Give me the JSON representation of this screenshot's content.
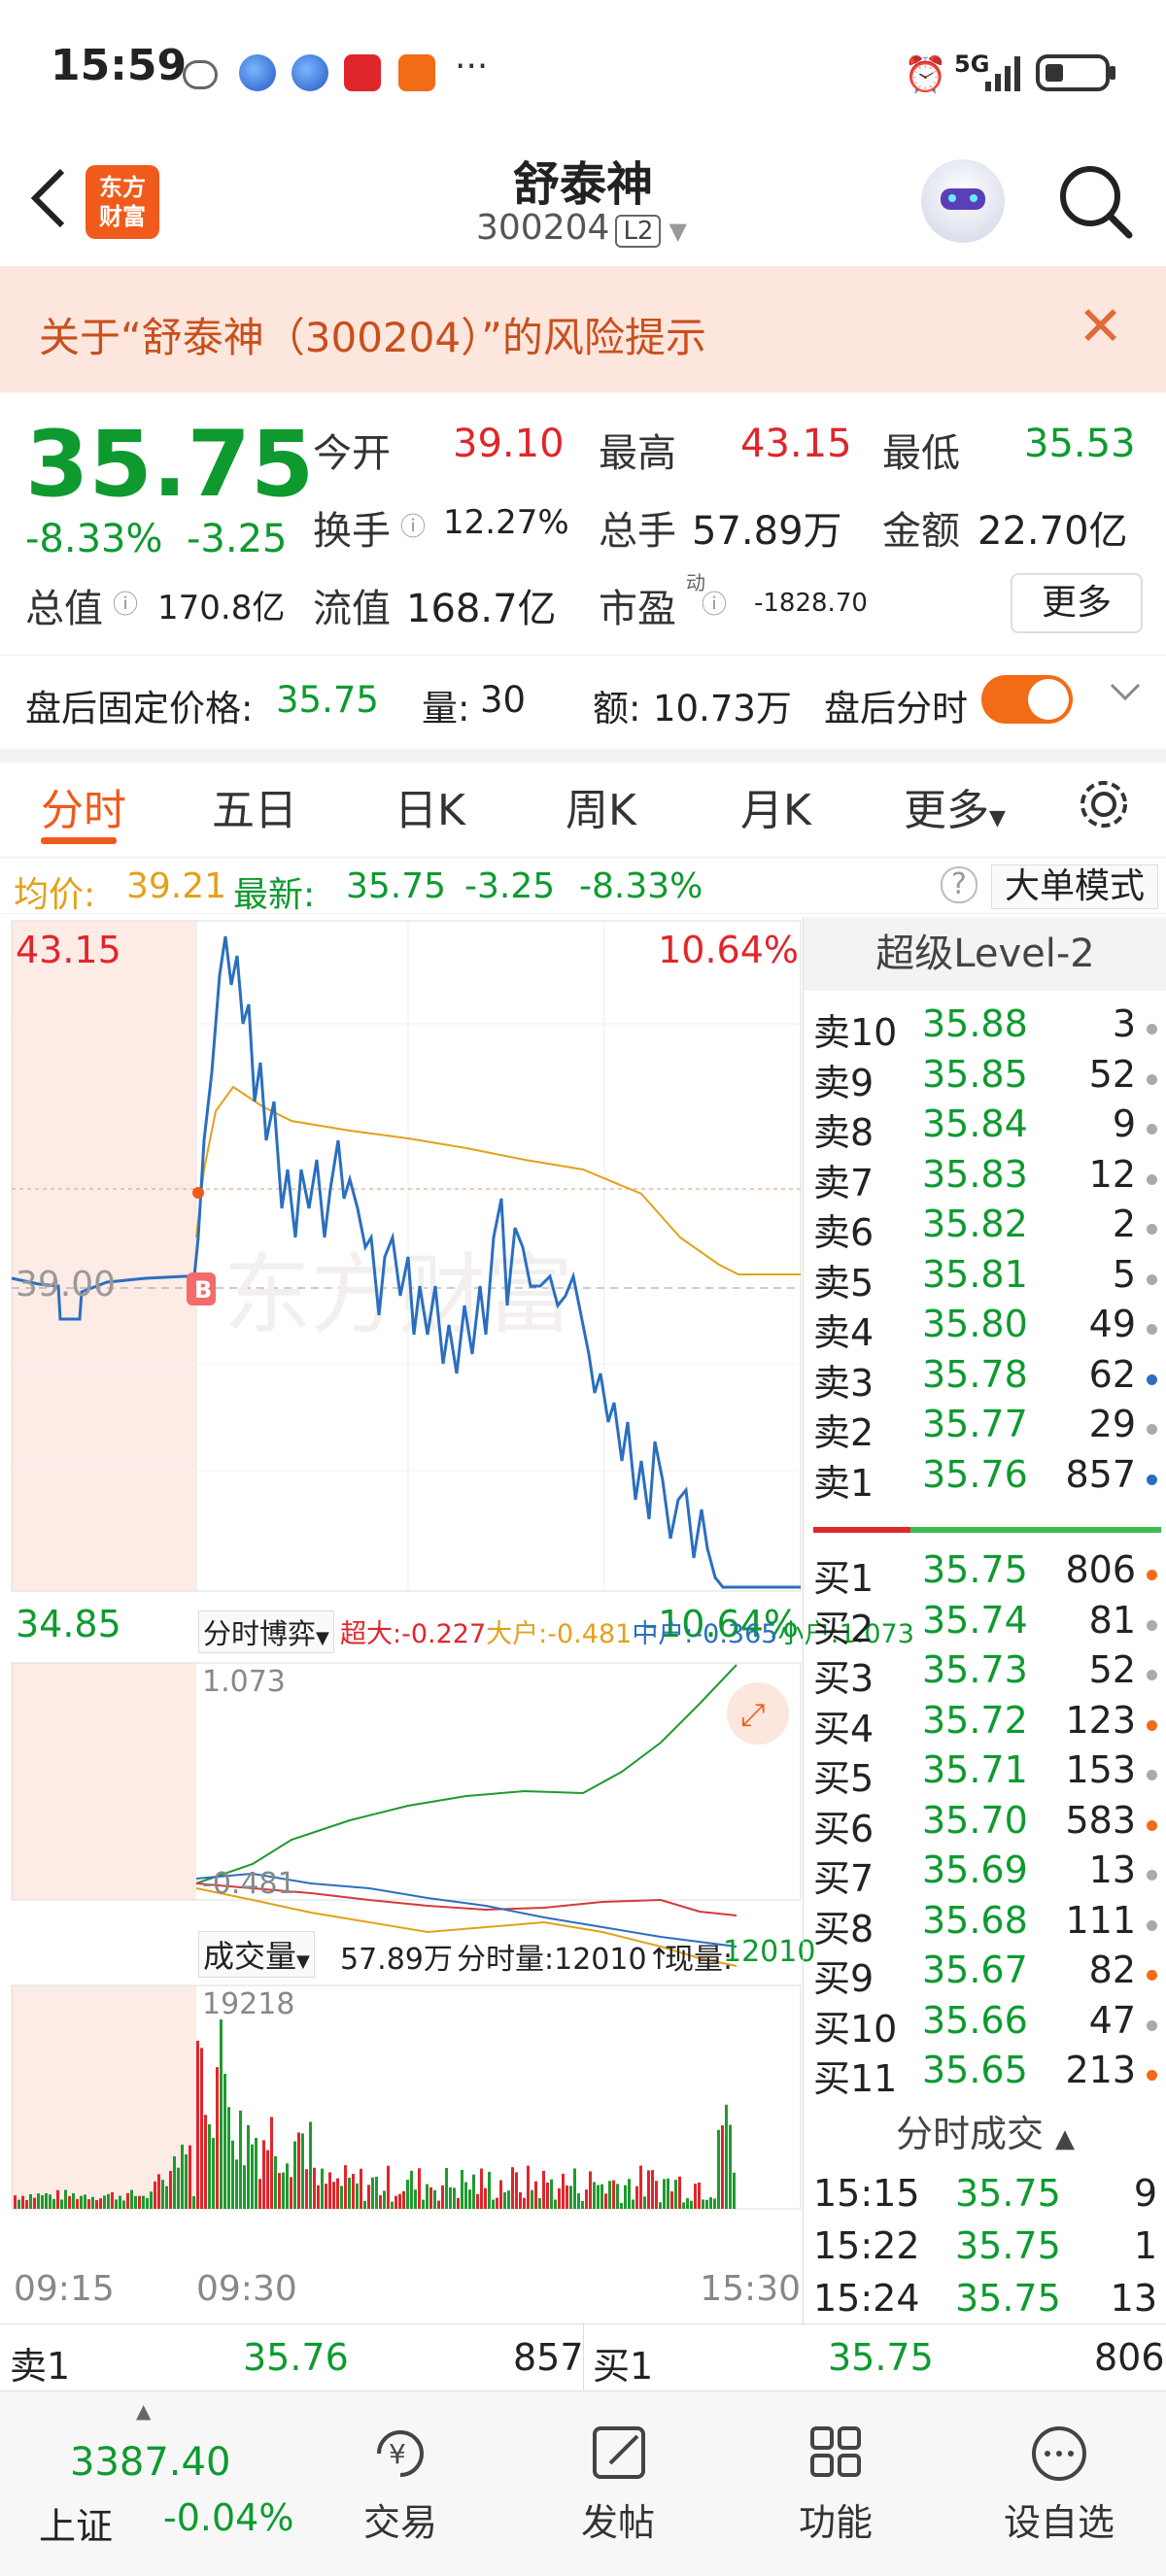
{
  "status_bar": {
    "time": "15:59",
    "network": "5G"
  },
  "header": {
    "back_icon": "chevron-left-icon",
    "logo_text_1": "东方",
    "logo_text_2": "财富",
    "title": "舒泰神",
    "code": "300204",
    "level_badge": "L2"
  },
  "banner": {
    "text": "关于“舒泰神（300204）”的风险提示"
  },
  "quote": {
    "price": "35.75",
    "change_pct": "-8.33%",
    "change": "-3.25",
    "open_label": "今开",
    "open": "39.10",
    "high_label": "最高",
    "high": "43.15",
    "low_label": "最低",
    "low": "35.53",
    "turnover_label": "换手",
    "turnover": "12.27%",
    "volume_label": "总手",
    "volume": "57.89万",
    "amount_label": "金额",
    "amount": "22.70亿",
    "mktcap_label": "总值",
    "mktcap": "170.8亿",
    "float_label": "流值",
    "float": "168.7亿",
    "pe_label": "市盈",
    "pe_sup": "动",
    "pe": "-1828.70",
    "more_label": "更多"
  },
  "after_hours": {
    "price_label": "盘后固定价格:",
    "price": "35.75",
    "vol_label": "量:",
    "vol": "30",
    "amt_label": "额:",
    "amt": "10.73万",
    "timeshare_label": "盘后分时"
  },
  "tabs": [
    "分时",
    "五日",
    "日K",
    "周K",
    "月K",
    "更多"
  ],
  "avg_line": {
    "avg_label": "均价:",
    "avg": "39.21",
    "latest_label": "最新:",
    "latest": "35.75",
    "chg": "-3.25",
    "pct": "-8.33%",
    "mode_label": "大单模式"
  },
  "chart": {
    "top_price": "43.15",
    "top_pct": "10.64%",
    "mid_price": "39.00",
    "bottom_price": "34.85",
    "bottom_pct": "-10.64%",
    "watermark": "东方财富",
    "marker_b": "B",
    "game_label": "分时博弈",
    "super_label": "超大:",
    "super": "-0.227",
    "big_label": "大户:",
    "big": "-0.481",
    "mid_label": "中户:",
    "mid": "-0.365",
    "small_label": "小户:",
    "small": "1.073",
    "ind_top": "1.073",
    "ind_bottom": "-0.481",
    "vol_tab": "成交量",
    "vol_total": "57.89万",
    "vol_now_label": "分时量:12010↑",
    "vol_cur_label": "现量:",
    "vol_cur": "12010",
    "vol_max": "19218",
    "time_start": "09:15",
    "time_open": "09:30",
    "time_end": "15:30"
  },
  "order_book": {
    "title": "超级Level-2",
    "sells": [
      {
        "label": "卖10",
        "price": "35.88",
        "vol": "3",
        "dot": "#aaaaaa"
      },
      {
        "label": "卖9",
        "price": "35.85",
        "vol": "52",
        "dot": "#aaaaaa"
      },
      {
        "label": "卖8",
        "price": "35.84",
        "vol": "9",
        "dot": "#aaaaaa"
      },
      {
        "label": "卖7",
        "price": "35.83",
        "vol": "12",
        "dot": "#aaaaaa"
      },
      {
        "label": "卖6",
        "price": "35.82",
        "vol": "2",
        "dot": "#aaaaaa"
      },
      {
        "label": "卖5",
        "price": "35.81",
        "vol": "5",
        "dot": "#aaaaaa"
      },
      {
        "label": "卖4",
        "price": "35.80",
        "vol": "49",
        "dot": "#aaaaaa"
      },
      {
        "label": "卖3",
        "price": "35.78",
        "vol": "62",
        "dot": "#2a6fbf"
      },
      {
        "label": "卖2",
        "price": "35.77",
        "vol": "29",
        "dot": "#aaaaaa"
      },
      {
        "label": "卖1",
        "price": "35.76",
        "vol": "857",
        "dot": "#2a6fbf"
      }
    ],
    "buys": [
      {
        "label": "买1",
        "price": "35.75",
        "vol": "806",
        "dot": "#f36b16"
      },
      {
        "label": "买2",
        "price": "35.74",
        "vol": "81",
        "dot": "#aaaaaa"
      },
      {
        "label": "买3",
        "price": "35.73",
        "vol": "52",
        "dot": "#aaaaaa"
      },
      {
        "label": "买4",
        "price": "35.72",
        "vol": "123",
        "dot": "#f36b16"
      },
      {
        "label": "买5",
        "price": "35.71",
        "vol": "153",
        "dot": "#aaaaaa"
      },
      {
        "label": "买6",
        "price": "35.70",
        "vol": "583",
        "dot": "#f36b16"
      },
      {
        "label": "买7",
        "price": "35.69",
        "vol": "13",
        "dot": "#aaaaaa"
      },
      {
        "label": "买8",
        "price": "35.68",
        "vol": "111",
        "dot": "#aaaaaa"
      },
      {
        "label": "买9",
        "price": "35.67",
        "vol": "82",
        "dot": "#f36b16"
      },
      {
        "label": "买10",
        "price": "35.66",
        "vol": "47",
        "dot": "#aaaaaa"
      },
      {
        "label": "买11",
        "price": "35.65",
        "vol": "213",
        "dot": "#f36b16"
      }
    ],
    "trades_title": "分时成交",
    "trades": [
      {
        "time": "15:15",
        "price": "35.75",
        "vol": "9"
      },
      {
        "time": "15:22",
        "price": "35.75",
        "vol": "1"
      },
      {
        "time": "15:24",
        "price": "35.75",
        "vol": "13"
      }
    ]
  },
  "bottom_strip": {
    "sell_label": "卖1",
    "sell_price": "35.76",
    "sell_vol": "857",
    "buy_label": "买1",
    "buy_price": "35.75",
    "buy_vol": "806"
  },
  "nav": {
    "index_value": "3387.40",
    "index_name": "上证",
    "index_change": "-0.04%",
    "trade": "交易",
    "post": "发帖",
    "features": "功能",
    "add_watch": "设自选"
  },
  "colors": {
    "up": "#e0262b",
    "down": "#0e9a2f",
    "accent": "#f05a1a",
    "price_line": "#2a6fbf",
    "avg_line": "#e3a11a"
  }
}
